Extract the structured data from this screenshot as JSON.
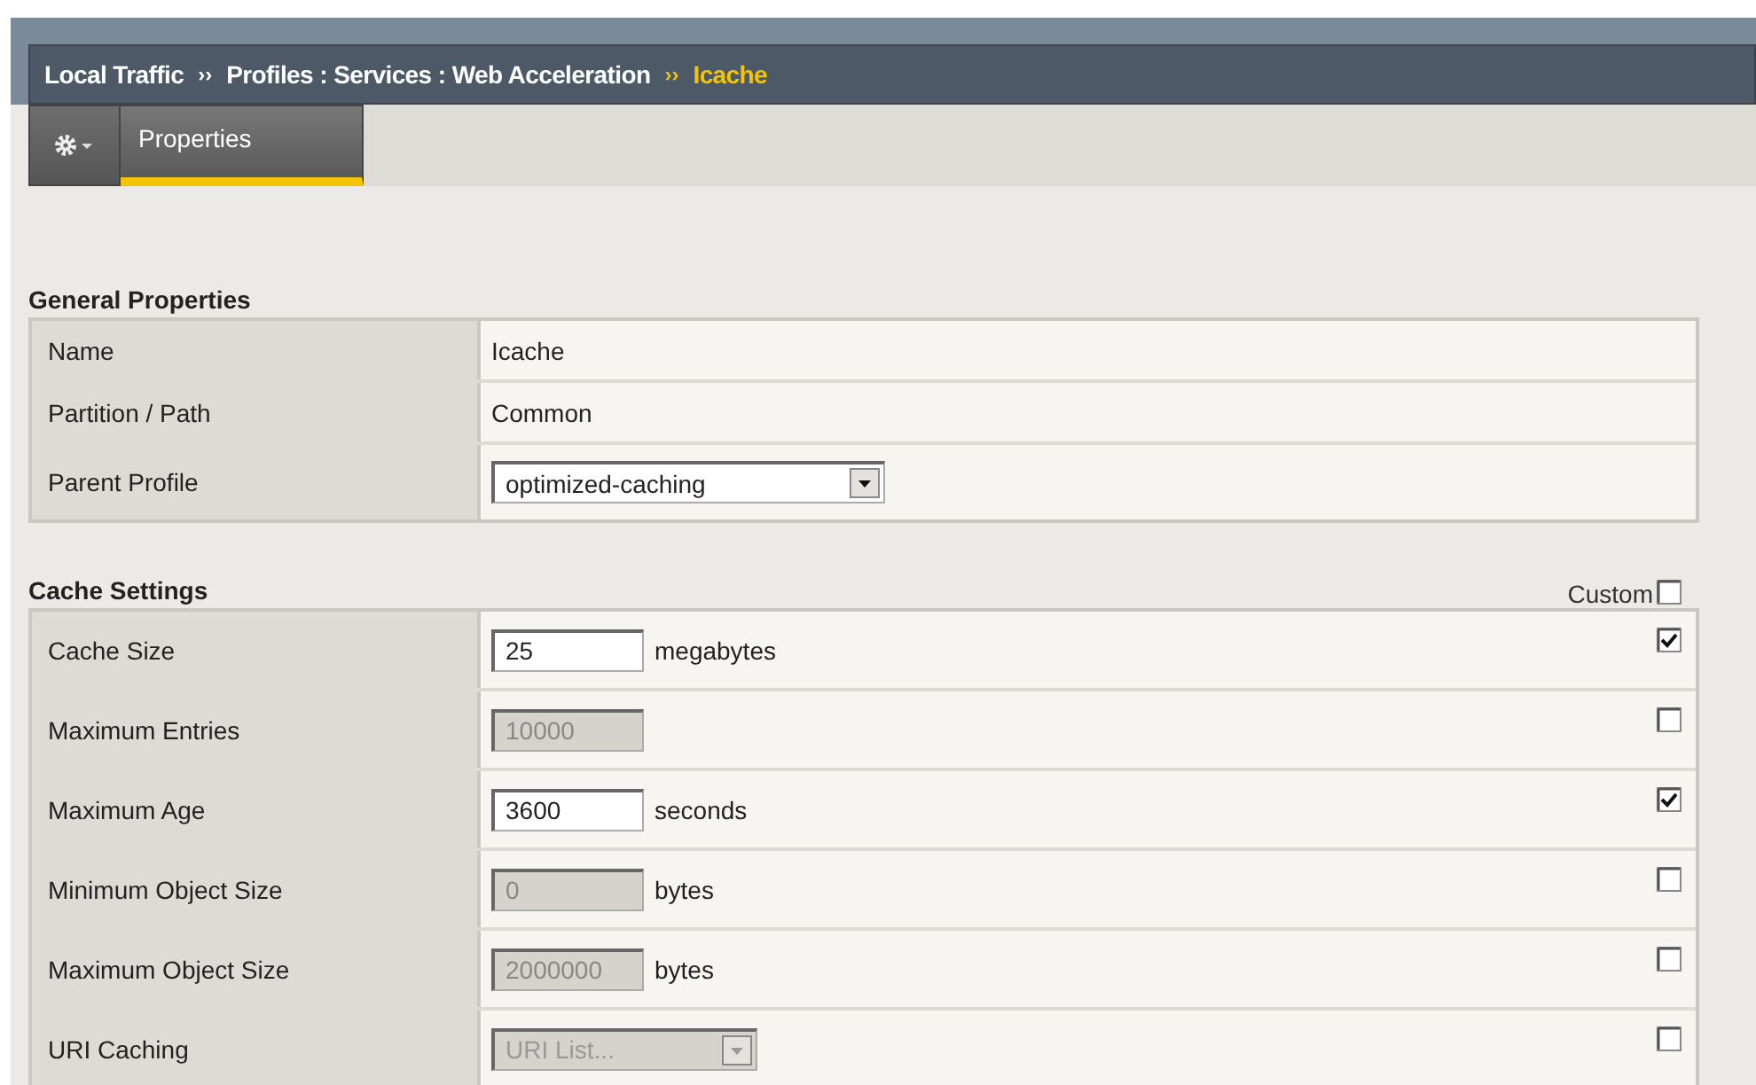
{
  "breadcrumb": [
    {
      "text": "Local Traffic",
      "current": false
    },
    {
      "separator": "››",
      "text": "Profiles : Services : Web Acceleration",
      "current": false
    },
    {
      "separator": "››",
      "text": "Icache",
      "current": true
    }
  ],
  "tabs": [
    {
      "label": "Properties",
      "selected": true
    }
  ],
  "general_properties": {
    "title": "General Properties",
    "rows": [
      {
        "kind": "text",
        "label": "Name",
        "value": "Icache"
      },
      {
        "kind": "text",
        "label": "Partition / Path",
        "value": "Common"
      },
      {
        "kind": "select",
        "label": "Parent Profile",
        "value": "optimized-caching",
        "disabled": false
      }
    ]
  },
  "cache_settings": {
    "title": "Cache Settings",
    "custom_label": "Custom",
    "custom_checked": false,
    "rows": [
      {
        "kind": "input",
        "label": "Cache Size",
        "value": "25",
        "unit": "megabytes",
        "disabled": false,
        "checked": true
      },
      {
        "kind": "input",
        "label": "Maximum Entries",
        "value": "10000",
        "disabled": true,
        "checked": false
      },
      {
        "kind": "input",
        "label": "Maximum Age",
        "value": "3600",
        "unit": "seconds",
        "disabled": false,
        "checked": true
      },
      {
        "kind": "input",
        "label": "Minimum Object Size",
        "value": "0",
        "unit": "bytes",
        "disabled": true,
        "checked": false
      },
      {
        "kind": "input",
        "label": "Maximum Object Size",
        "value": "2000000",
        "unit": "bytes",
        "disabled": true,
        "checked": false
      },
      {
        "kind": "select",
        "label": "URI Caching",
        "value": "URI List...",
        "disabled": true,
        "checked": false
      }
    ]
  }
}
